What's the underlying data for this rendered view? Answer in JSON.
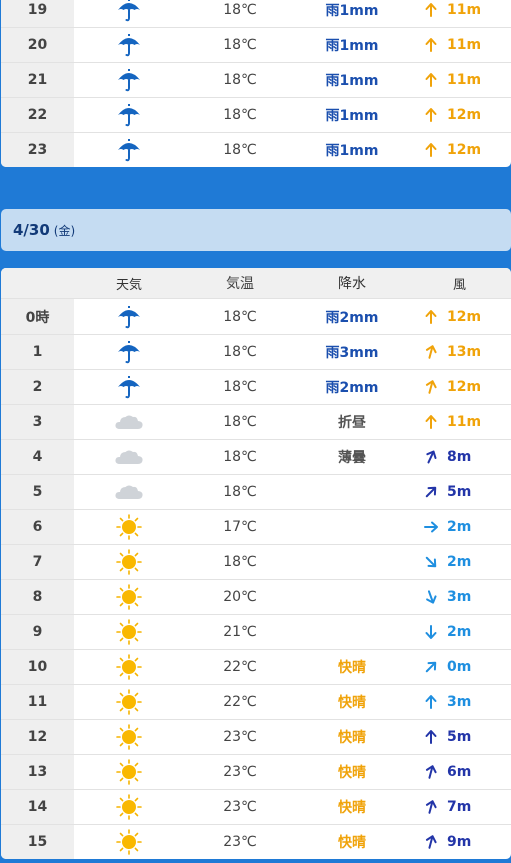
{
  "prev_day": {
    "rows": [
      {
        "hour": "19",
        "weather": "rain",
        "temp": "18℃",
        "precip": "雨1mm",
        "precip_kind": "rain",
        "wind": "11m",
        "wind_color": "orange",
        "wind_rot": 0
      },
      {
        "hour": "20",
        "weather": "rain",
        "temp": "18℃",
        "precip": "雨1mm",
        "precip_kind": "rain",
        "wind": "11m",
        "wind_color": "orange",
        "wind_rot": 0
      },
      {
        "hour": "21",
        "weather": "rain",
        "temp": "18℃",
        "precip": "雨1mm",
        "precip_kind": "rain",
        "wind": "11m",
        "wind_color": "orange",
        "wind_rot": 0
      },
      {
        "hour": "22",
        "weather": "rain",
        "temp": "18℃",
        "precip": "雨1mm",
        "precip_kind": "rain",
        "wind": "12m",
        "wind_color": "orange",
        "wind_rot": 0
      },
      {
        "hour": "23",
        "weather": "rain",
        "temp": "18℃",
        "precip": "雨1mm",
        "precip_kind": "rain",
        "wind": "12m",
        "wind_color": "orange",
        "wind_rot": 0
      }
    ]
  },
  "date_banner": {
    "date": "4/30",
    "weekday": "(金)"
  },
  "table_header": {
    "weather": "天気",
    "temp": "気温",
    "precip": "降水",
    "wind": "風"
  },
  "day": {
    "rows": [
      {
        "hour": "0時",
        "weather": "rain",
        "temp": "18℃",
        "precip": "雨2mm",
        "precip_kind": "rain",
        "wind": "12m",
        "wind_color": "orange",
        "wind_rot": 0
      },
      {
        "hour": "1",
        "weather": "rain",
        "temp": "18℃",
        "precip": "雨3mm",
        "precip_kind": "rain",
        "wind": "13m",
        "wind_color": "orange",
        "wind_rot": 15
      },
      {
        "hour": "2",
        "weather": "rain",
        "temp": "18℃",
        "precip": "雨2mm",
        "precip_kind": "rain",
        "wind": "12m",
        "wind_color": "orange",
        "wind_rot": 15
      },
      {
        "hour": "3",
        "weather": "cloud",
        "temp": "18℃",
        "precip": "折昼",
        "precip_kind": "gray",
        "wind": "11m",
        "wind_color": "orange",
        "wind_rot": 0
      },
      {
        "hour": "4",
        "weather": "cloud",
        "temp": "18℃",
        "precip": "薄曇",
        "precip_kind": "gray",
        "wind": "8m",
        "wind_color": "navy",
        "wind_rot": 25
      },
      {
        "hour": "5",
        "weather": "cloud",
        "temp": "18℃",
        "precip": "",
        "precip_kind": "gray",
        "wind": "5m",
        "wind_color": "navy",
        "wind_rot": 45
      },
      {
        "hour": "6",
        "weather": "sun",
        "temp": "17℃",
        "precip": "",
        "precip_kind": "gray",
        "wind": "2m",
        "wind_color": "blue",
        "wind_rot": 90
      },
      {
        "hour": "7",
        "weather": "sun",
        "temp": "18℃",
        "precip": "",
        "precip_kind": "gray",
        "wind": "2m",
        "wind_color": "blue",
        "wind_rot": 135
      },
      {
        "hour": "8",
        "weather": "sun",
        "temp": "20℃",
        "precip": "",
        "precip_kind": "gray",
        "wind": "3m",
        "wind_color": "blue",
        "wind_rot": 160
      },
      {
        "hour": "9",
        "weather": "sun",
        "temp": "21℃",
        "precip": "",
        "precip_kind": "gray",
        "wind": "2m",
        "wind_color": "blue",
        "wind_rot": 180
      },
      {
        "hour": "10",
        "weather": "sun",
        "temp": "22℃",
        "precip": "快晴",
        "precip_kind": "sunny",
        "wind": "0m",
        "wind_color": "blue",
        "wind_rot": 45
      },
      {
        "hour": "11",
        "weather": "sun",
        "temp": "22℃",
        "precip": "快晴",
        "precip_kind": "sunny",
        "wind": "3m",
        "wind_color": "blue",
        "wind_rot": 0
      },
      {
        "hour": "12",
        "weather": "sun",
        "temp": "23℃",
        "precip": "快晴",
        "precip_kind": "sunny",
        "wind": "5m",
        "wind_color": "navy",
        "wind_rot": 0
      },
      {
        "hour": "13",
        "weather": "sun",
        "temp": "23℃",
        "precip": "快晴",
        "precip_kind": "sunny",
        "wind": "6m",
        "wind_color": "navy",
        "wind_rot": 15
      },
      {
        "hour": "14",
        "weather": "sun",
        "temp": "23℃",
        "precip": "快晴",
        "precip_kind": "sunny",
        "wind": "7m",
        "wind_color": "navy",
        "wind_rot": 15
      },
      {
        "hour": "15",
        "weather": "sun",
        "temp": "23℃",
        "precip": "快晴",
        "precip_kind": "sunny",
        "wind": "9m",
        "wind_color": "navy",
        "wind_rot": 15
      }
    ]
  },
  "colors": {
    "page_bg": "#1f7ad6",
    "rain_text": "#1b4fae",
    "sunny_text": "#f0a30a",
    "wind_orange": "#f0a30a",
    "wind_blue": "#1f8fe0",
    "wind_navy": "#2335a8"
  }
}
